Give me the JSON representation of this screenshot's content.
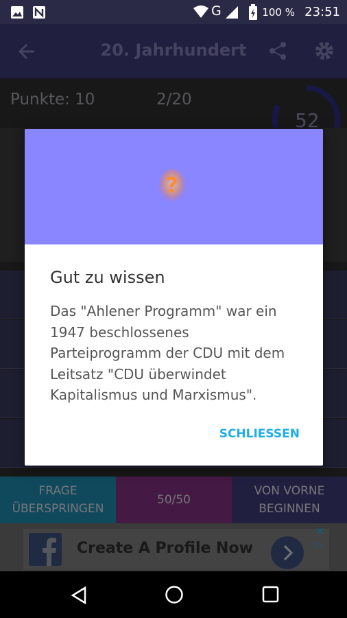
{
  "status_bar": {
    "battery": "100 %",
    "time": "23:51"
  },
  "app_bar": {
    "title": "20. Jahrhundert"
  },
  "quiz": {
    "score": "Punkte: 10",
    "progress": "2/20",
    "timer": "52"
  },
  "bottom_buttons": [
    {
      "label": "FRAGE ÜBERSPRINGEN",
      "color": "#1f86a8"
    },
    {
      "label": "50/50",
      "color": "#7c2f7a"
    },
    {
      "label": "VON VORNE BEGINNEN",
      "color": "#3d3a73"
    }
  ],
  "ad": {
    "text": "Create A Profile Now",
    "brand_color": "#1877f2"
  },
  "dialog": {
    "title": "Gut zu wissen",
    "body": "Das \"Ahlener Programm\" war ein 1947 beschlossenes Parteiprogramm der CDU mit dem Leitsatz \"CDU überwindet Kapitalismus und Marxismus\".",
    "close_label": "SCHLIESSEN",
    "header_color": "#8a86ff",
    "icon": "question-mark-icon"
  }
}
